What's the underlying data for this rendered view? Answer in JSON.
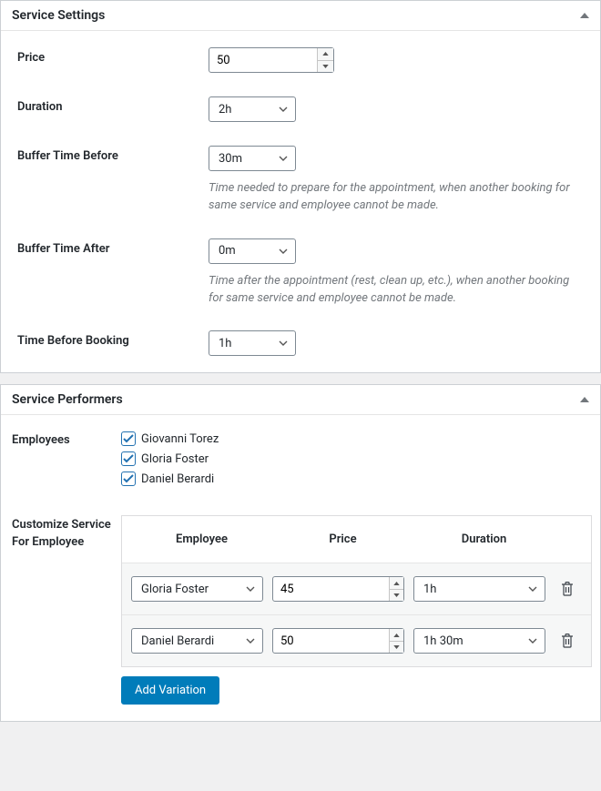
{
  "settings": {
    "title": "Service Settings",
    "price": {
      "label": "Price",
      "value": "50"
    },
    "duration": {
      "label": "Duration",
      "value": "2h"
    },
    "buffer_before": {
      "label": "Buffer Time Before",
      "value": "30m",
      "help": "Time needed to prepare for the appointment, when another booking for same service and employee cannot be made."
    },
    "buffer_after": {
      "label": "Buffer Time After",
      "value": "0m",
      "help": "Time after the appointment (rest, clean up, etc.), when another booking for same service and employee cannot be made."
    },
    "time_before_booking": {
      "label": "Time Before Booking",
      "value": "1h"
    }
  },
  "performers": {
    "title": "Service Performers",
    "employees_label": "Employees",
    "employees": [
      {
        "name": "Giovanni Torez",
        "checked": true
      },
      {
        "name": "Gloria Foster",
        "checked": true
      },
      {
        "name": "Daniel Berardi",
        "checked": true
      }
    ],
    "customize_label": "Customize Service For Employee",
    "headers": {
      "employee": "Employee",
      "price": "Price",
      "duration": "Duration"
    },
    "rows": [
      {
        "employee": "Gloria Foster",
        "price": "45",
        "duration": "1h"
      },
      {
        "employee": "Daniel Berardi",
        "price": "50",
        "duration": "1h 30m"
      }
    ],
    "add_label": "Add Variation"
  }
}
